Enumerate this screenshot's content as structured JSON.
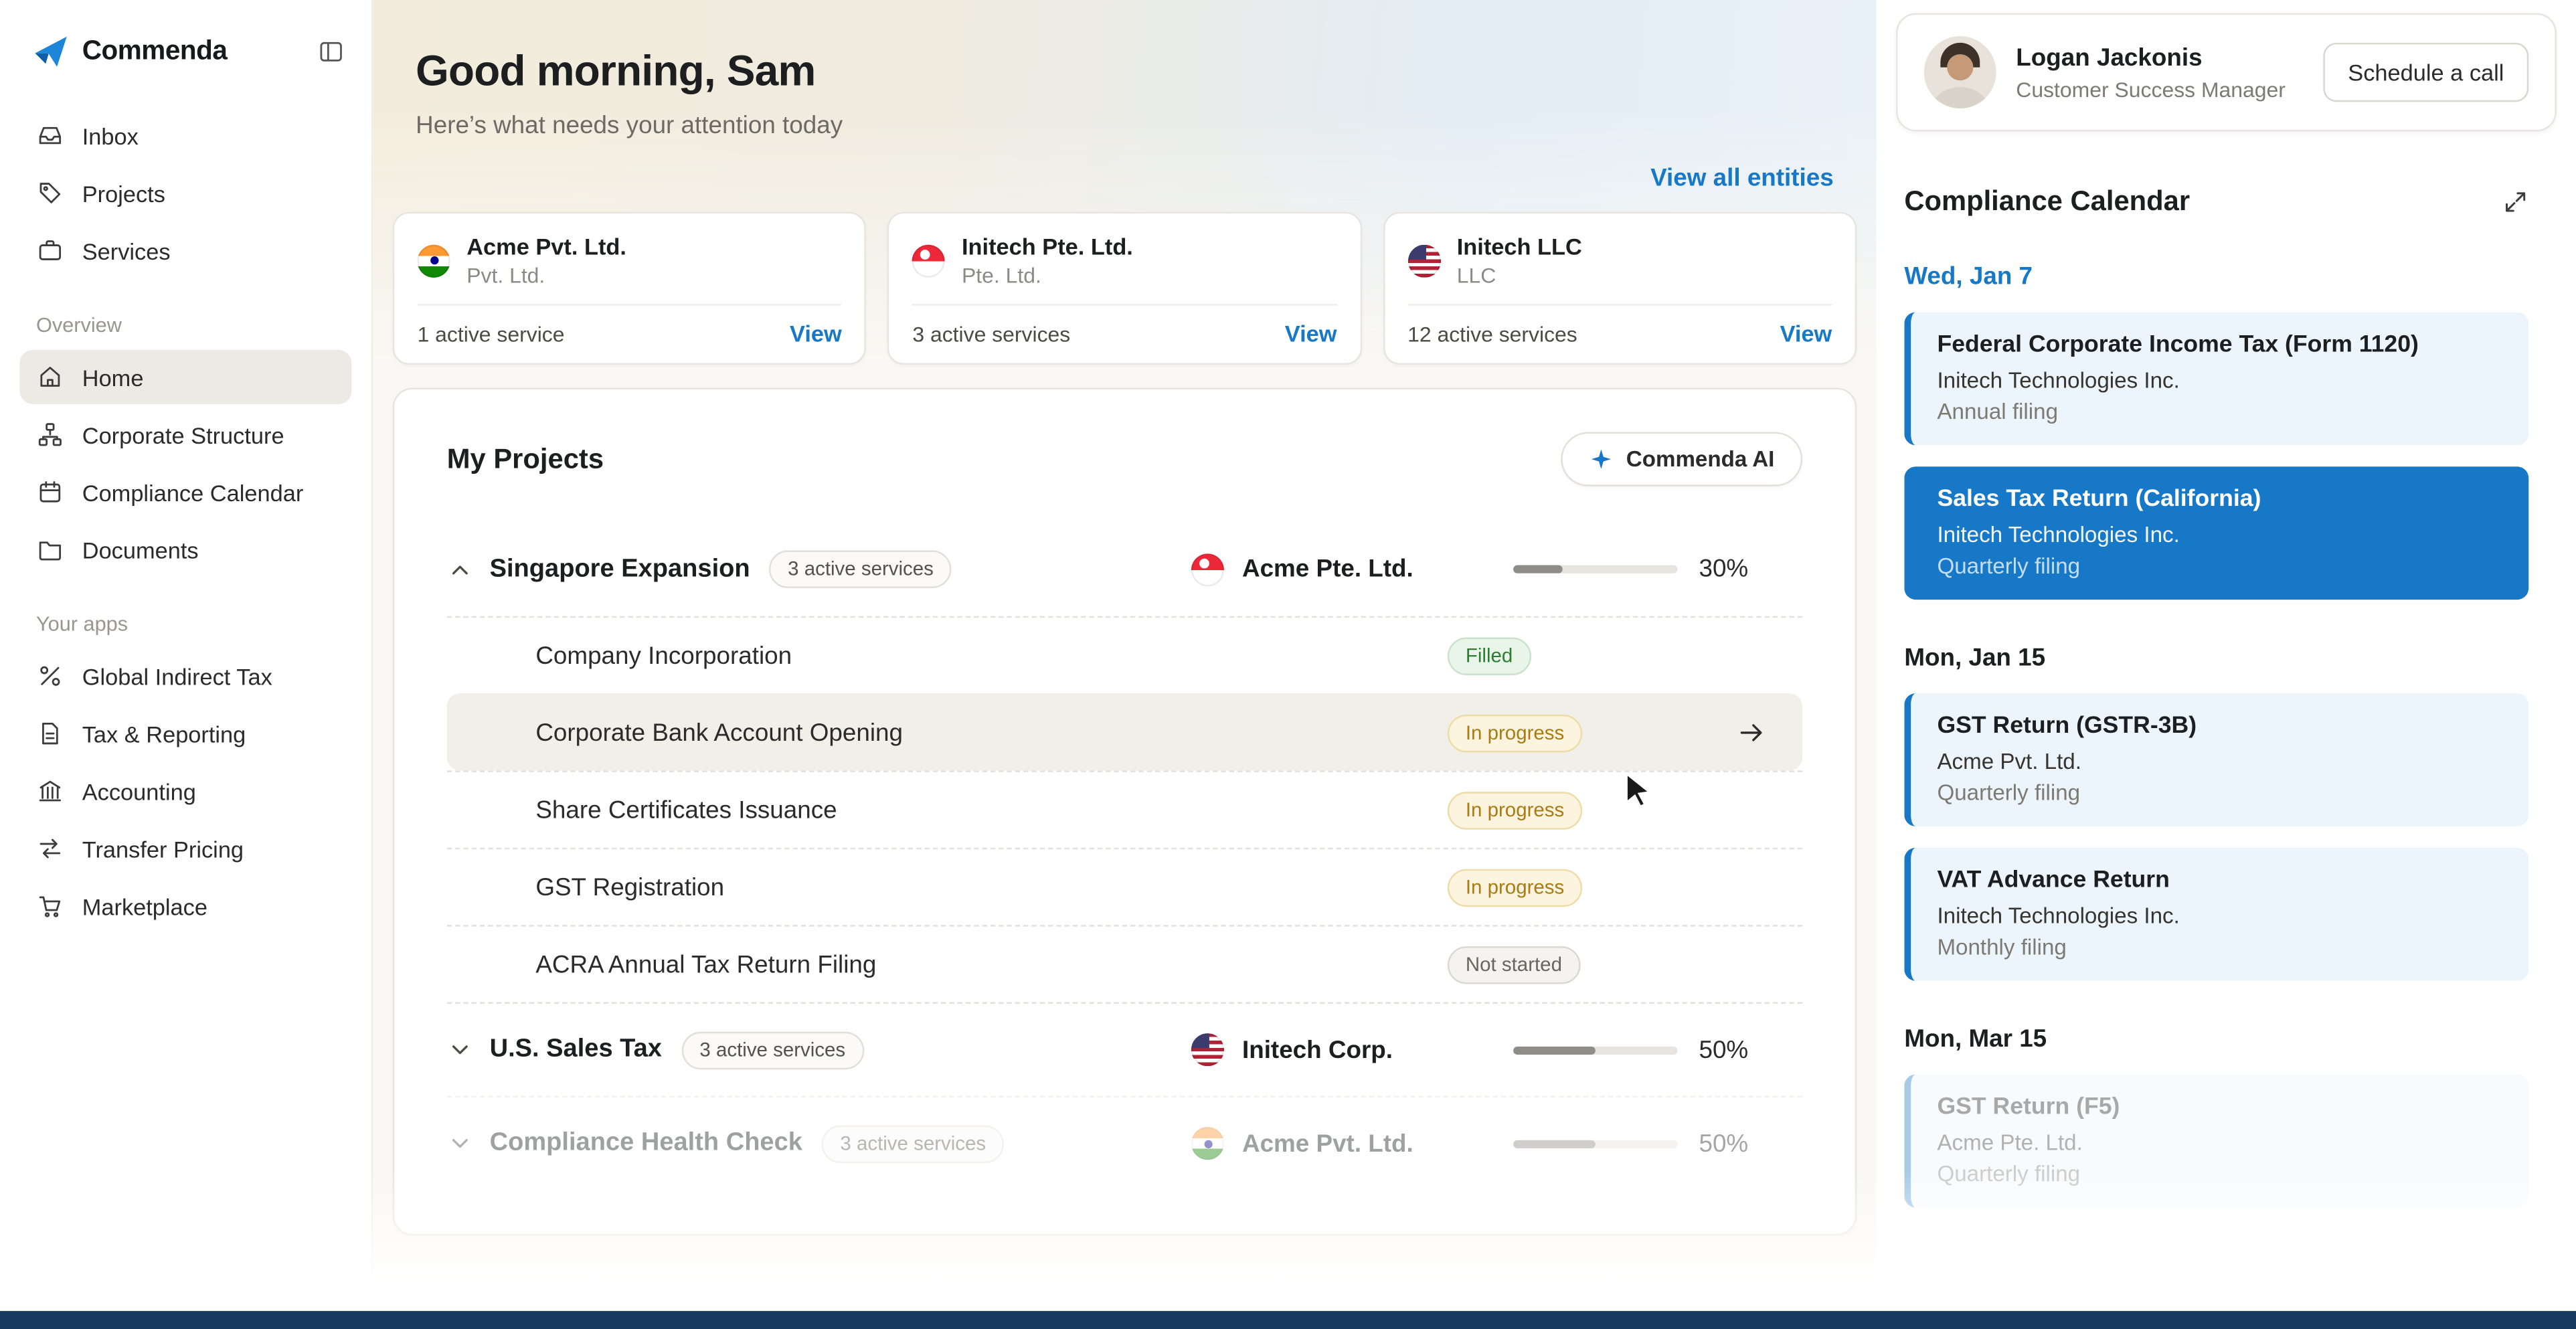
{
  "brand": {
    "name": "Commenda"
  },
  "colors": {
    "accent": "#1778C8",
    "event_bg": "#EDF5FC",
    "event_selected_bg": "#1778C8",
    "status_filled": "#2E7D32",
    "status_in_progress": "#A97B13",
    "status_not_started": "#68655F",
    "dock_bar": "#16395F"
  },
  "sidebar": {
    "primary": [
      {
        "label": "Inbox",
        "icon": "inbox-icon"
      },
      {
        "label": "Projects",
        "icon": "tag-icon"
      },
      {
        "label": "Services",
        "icon": "briefcase-icon"
      }
    ],
    "sections": [
      {
        "title": "Overview",
        "items": [
          {
            "label": "Home",
            "icon": "home-icon",
            "active": true
          },
          {
            "label": "Corporate Structure",
            "icon": "hierarchy-icon"
          },
          {
            "label": "Compliance Calendar",
            "icon": "calendar-icon"
          },
          {
            "label": "Documents",
            "icon": "folder-icon"
          }
        ]
      },
      {
        "title": "Your apps",
        "items": [
          {
            "label": "Global Indirect Tax",
            "icon": "percent-icon"
          },
          {
            "label": "Tax & Reporting",
            "icon": "document-icon"
          },
          {
            "label": "Accounting",
            "icon": "building-icon"
          },
          {
            "label": "Transfer Pricing",
            "icon": "transfer-icon"
          },
          {
            "label": "Marketplace",
            "icon": "cart-icon"
          }
        ]
      }
    ]
  },
  "header": {
    "greeting": "Good morning, Sam",
    "subtitle": "Here’s what needs your attention today",
    "view_all": "View all entities"
  },
  "entities": [
    {
      "name": "Acme Pvt. Ltd.",
      "type": "Pvt. Ltd.",
      "flag": "india",
      "services": "1 active service",
      "action": "View"
    },
    {
      "name": "Initech Pte. Ltd.",
      "type": "Pte. Ltd.",
      "flag": "singapore",
      "services": "3 active services",
      "action": "View"
    },
    {
      "name": "Initech LLC",
      "type": "LLC",
      "flag": "usa",
      "services": "12 active services",
      "action": "View"
    }
  ],
  "projects": {
    "title": "My Projects",
    "ai_button": "Commenda AI",
    "groups": [
      {
        "name": "Singapore Expansion",
        "badge": "3 active services",
        "entity": "Acme Pte. Ltd.",
        "flag": "singapore",
        "progress": 30,
        "progress_label": "30%",
        "expanded": true,
        "tasks": [
          {
            "name": "Company Incorporation",
            "status": "Filled"
          },
          {
            "name": "Corporate Bank Account Opening",
            "status": "In progress",
            "hovered": true
          },
          {
            "name": "Share Certificates Issuance",
            "status": "In progress"
          },
          {
            "name": "GST Registration",
            "status": "In progress"
          },
          {
            "name": "ACRA Annual Tax Return Filing",
            "status": "Not started"
          }
        ]
      },
      {
        "name": "U.S. Sales Tax",
        "badge": "3 active services",
        "entity": "Initech Corp.",
        "flag": "usa",
        "progress": 50,
        "progress_label": "50%",
        "expanded": false
      },
      {
        "name": "Compliance Health Check",
        "badge": "3 active services",
        "entity": "Acme Pvt. Ltd.",
        "flag": "india",
        "progress": 50,
        "progress_label": "50%",
        "expanded": false,
        "faded": true
      }
    ]
  },
  "advisor": {
    "name": "Logan Jackonis",
    "role": "Customer Success Manager",
    "action": "Schedule a call"
  },
  "calendar": {
    "title": "Compliance Calendar",
    "days": [
      {
        "date": "Wed, Jan 7",
        "highlight": true,
        "events": [
          {
            "title": "Federal Corporate Income Tax (Form 1120)",
            "company": "Initech Technologies Inc.",
            "frequency": "Annual filing",
            "selected": false
          },
          {
            "title": "Sales Tax Return (California)",
            "company": "Initech Technologies Inc.",
            "frequency": "Quarterly filing",
            "selected": true
          }
        ]
      },
      {
        "date": "Mon, Jan 15",
        "events": [
          {
            "title": "GST Return (GSTR-3B)",
            "company": "Acme Pvt. Ltd.",
            "frequency": "Quarterly filing"
          },
          {
            "title": "VAT Advance Return",
            "company": "Initech Technologies Inc.",
            "frequency": "Monthly filing"
          }
        ]
      },
      {
        "date": "Mon, Mar 15",
        "events": [
          {
            "title": "GST Return (F5)",
            "company": "Acme Pte. Ltd.",
            "frequency": "Quarterly filing",
            "faded": true
          }
        ]
      }
    ]
  }
}
